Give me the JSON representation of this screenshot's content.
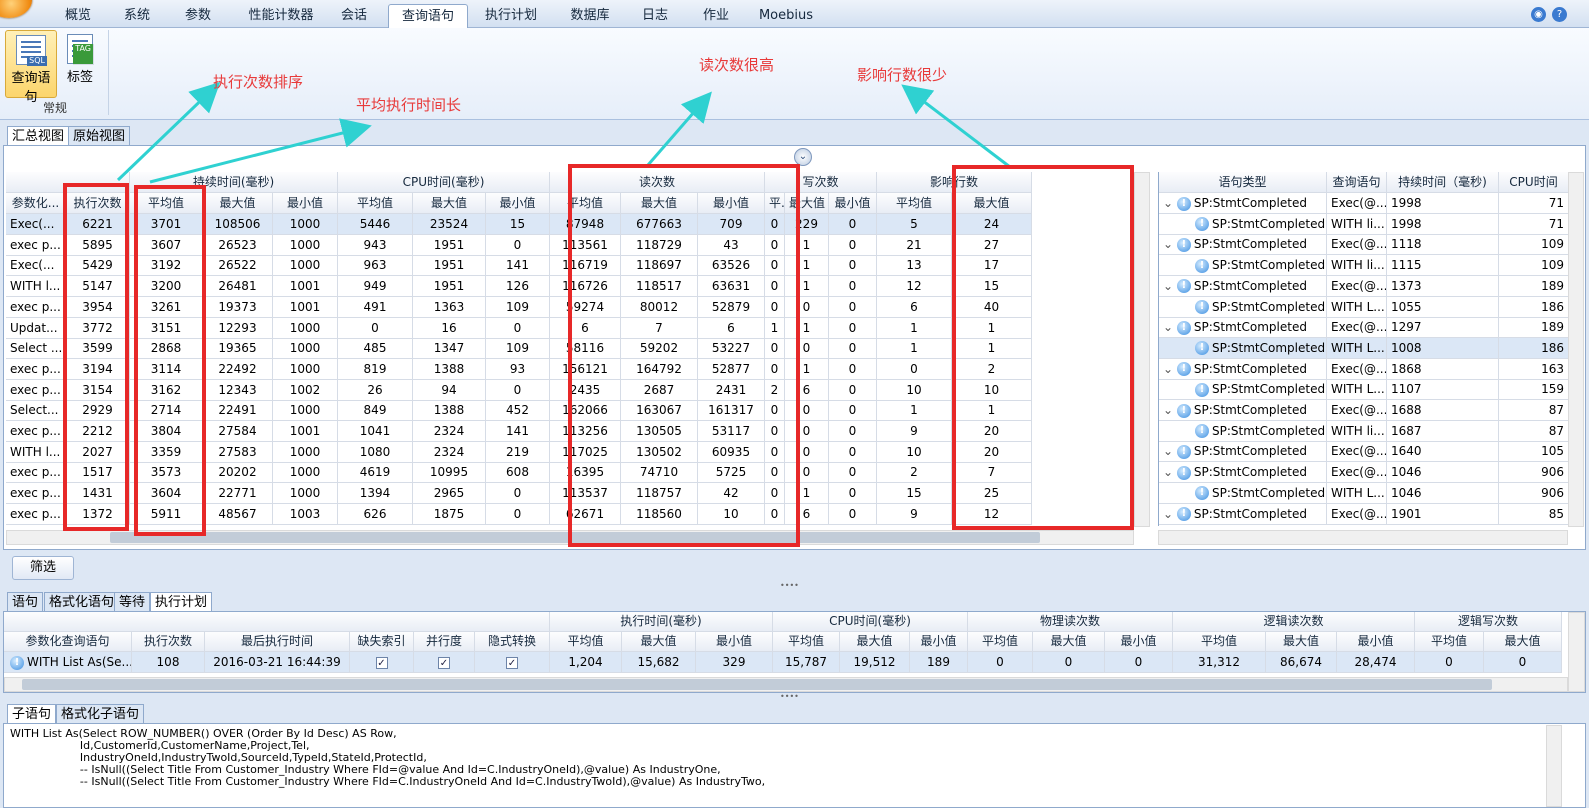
{
  "menu_tabs": [
    "概览",
    "系统",
    "参数",
    "性能计数器",
    "会话",
    "查询语句",
    "执行计划",
    "数据库",
    "日志",
    "作业",
    "Moebius"
  ],
  "ribbon": {
    "buttons": [
      {
        "label": "查询语句",
        "badge": "SQL"
      },
      {
        "label": "标签",
        "badge": "TAG"
      }
    ],
    "group": "常规"
  },
  "view_tabs": [
    "汇总视图",
    "原始视图"
  ],
  "summary": {
    "groups": [
      "持续时间(毫秒)",
      "CPU时间(毫秒)",
      "读次数",
      "写次数",
      "影响行数"
    ],
    "headers": [
      "参数化...",
      "执行次数",
      "平均值",
      "最大值",
      "最小值",
      "平均值",
      "最大值",
      "最小值",
      "平均值",
      "最大值",
      "最小值",
      "平...",
      "最大值",
      "最小值",
      "平均值",
      "最大值"
    ],
    "rows": [
      [
        "Exec(...",
        "6221",
        "3701",
        "108506",
        "1000",
        "5446",
        "23524",
        "15",
        "87948",
        "677663",
        "709",
        "0",
        "229",
        "0",
        "5",
        "24"
      ],
      [
        "exec p...",
        "5895",
        "3607",
        "26523",
        "1000",
        "943",
        "1951",
        "0",
        "113561",
        "118729",
        "43",
        "0",
        "1",
        "0",
        "21",
        "27"
      ],
      [
        "Exec(...",
        "5429",
        "3192",
        "26522",
        "1000",
        "963",
        "1951",
        "141",
        "116719",
        "118697",
        "63526",
        "0",
        "1",
        "0",
        "13",
        "17"
      ],
      [
        "WITH l...",
        "5147",
        "3200",
        "26481",
        "1001",
        "949",
        "1951",
        "126",
        "116726",
        "118517",
        "63631",
        "0",
        "1",
        "0",
        "12",
        "15"
      ],
      [
        "exec p...",
        "3954",
        "3261",
        "19373",
        "1001",
        "491",
        "1363",
        "109",
        "59274",
        "80012",
        "52879",
        "0",
        "0",
        "0",
        "6",
        "40"
      ],
      [
        "Updat...",
        "3772",
        "3151",
        "12293",
        "1000",
        "0",
        "16",
        "0",
        "6",
        "7",
        "6",
        "1",
        "1",
        "0",
        "1",
        "1"
      ],
      [
        "Select ...",
        "3599",
        "2868",
        "19365",
        "1000",
        "485",
        "1347",
        "109",
        "58116",
        "59202",
        "53227",
        "0",
        "0",
        "0",
        "1",
        "1"
      ],
      [
        "exec p...",
        "3194",
        "3114",
        "22492",
        "1000",
        "819",
        "1388",
        "93",
        "156121",
        "164792",
        "52877",
        "0",
        "1",
        "0",
        "0",
        "2"
      ],
      [
        "exec p...",
        "3154",
        "3162",
        "12343",
        "1002",
        "26",
        "94",
        "0",
        "2435",
        "2687",
        "2431",
        "2",
        "6",
        "0",
        "10",
        "10"
      ],
      [
        "Select...",
        "2929",
        "2714",
        "22491",
        "1000",
        "849",
        "1388",
        "452",
        "162066",
        "163067",
        "161317",
        "0",
        "0",
        "0",
        "1",
        "1"
      ],
      [
        "exec p...",
        "2212",
        "3804",
        "27584",
        "1001",
        "1041",
        "2324",
        "141",
        "113256",
        "130505",
        "53117",
        "0",
        "0",
        "0",
        "9",
        "20"
      ],
      [
        "WITH l...",
        "2027",
        "3359",
        "27583",
        "1000",
        "1080",
        "2324",
        "219",
        "117025",
        "130502",
        "60935",
        "0",
        "0",
        "0",
        "10",
        "20"
      ],
      [
        "exec p...",
        "1517",
        "3573",
        "20202",
        "1000",
        "4619",
        "10995",
        "608",
        "16395",
        "74710",
        "5725",
        "0",
        "0",
        "0",
        "2",
        "7"
      ],
      [
        "exec p...",
        "1431",
        "3604",
        "22771",
        "1000",
        "1394",
        "2965",
        "0",
        "113537",
        "118757",
        "42",
        "0",
        "1",
        "0",
        "15",
        "25"
      ],
      [
        "exec p...",
        "1372",
        "5911",
        "48567",
        "1003",
        "626",
        "1875",
        "0",
        "62671",
        "118560",
        "10",
        "0",
        "6",
        "0",
        "9",
        "12"
      ]
    ]
  },
  "annotations": [
    "执行次数排序",
    "平均执行时间长",
    "读次数很高",
    "影响行数很少"
  ],
  "events": {
    "headers": [
      "语句类型",
      "查询语句",
      "持续时间（毫秒)",
      "CPU时间"
    ],
    "rows": [
      {
        "type": "SP:StmtCompleted",
        "query": "Exec(@...",
        "dur": "1998",
        "cpu": "71",
        "parent": true
      },
      {
        "type": "SP:StmtCompleted",
        "query": "WITH li...",
        "dur": "1998",
        "cpu": "71",
        "parent": false
      },
      {
        "type": "SP:StmtCompleted",
        "query": "Exec(@...",
        "dur": "1118",
        "cpu": "109",
        "parent": true
      },
      {
        "type": "SP:StmtCompleted",
        "query": "WITH li...",
        "dur": "1115",
        "cpu": "109",
        "parent": false
      },
      {
        "type": "SP:StmtCompleted",
        "query": "Exec(@...",
        "dur": "1373",
        "cpu": "189",
        "parent": true
      },
      {
        "type": "SP:StmtCompleted",
        "query": "WITH L...",
        "dur": "1055",
        "cpu": "186",
        "parent": false
      },
      {
        "type": "SP:StmtCompleted",
        "query": "Exec(@...",
        "dur": "1297",
        "cpu": "189",
        "parent": true
      },
      {
        "type": "SP:StmtCompleted",
        "query": "WITH L...",
        "dur": "1008",
        "cpu": "186",
        "parent": false,
        "selected": true
      },
      {
        "type": "SP:StmtCompleted",
        "query": "Exec(@...",
        "dur": "1868",
        "cpu": "163",
        "parent": true
      },
      {
        "type": "SP:StmtCompleted",
        "query": "WITH L...",
        "dur": "1107",
        "cpu": "159",
        "parent": false
      },
      {
        "type": "SP:StmtCompleted",
        "query": "Exec(@...",
        "dur": "1688",
        "cpu": "87",
        "parent": true
      },
      {
        "type": "SP:StmtCompleted",
        "query": "WITH li...",
        "dur": "1687",
        "cpu": "87",
        "parent": false
      },
      {
        "type": "SP:StmtCompleted",
        "query": "Exec(@...",
        "dur": "1640",
        "cpu": "105",
        "parent": true
      },
      {
        "type": "SP:StmtCompleted",
        "query": "Exec(@...",
        "dur": "1046",
        "cpu": "906",
        "parent": true
      },
      {
        "type": "SP:StmtCompleted",
        "query": "WITH L...",
        "dur": "1046",
        "cpu": "906",
        "parent": false
      },
      {
        "type": "SP:StmtCompleted",
        "query": "Exec(@...",
        "dur": "1901",
        "cpu": "85",
        "parent": true
      }
    ]
  },
  "filter_button": "筛选",
  "detail_tabs": [
    "语句",
    "格式化语句",
    "等待",
    "执行计划"
  ],
  "detail": {
    "groups": [
      "执行时间(毫秒)",
      "CPU时间(毫秒)",
      "物理读次数",
      "逻辑读次数",
      "逻辑写次数"
    ],
    "headers": [
      "参数化查询语句",
      "执行次数",
      "最后执行时间",
      "缺失索引",
      "并行度",
      "隐式转换",
      "平均值",
      "最大值",
      "最小值",
      "平均值",
      "最大值",
      "最小值",
      "平均值",
      "最大值",
      "最小值",
      "平均值",
      "最大值",
      "最小值",
      "平均值",
      "最大值"
    ],
    "row": [
      "WITH List As(Se...",
      "108",
      "2016-03-21 16:44:39",
      "",
      "",
      "",
      "1,204",
      "15,682",
      "329",
      "15,787",
      "19,512",
      "189",
      "0",
      "0",
      "0",
      "31,312",
      "86,674",
      "28,474",
      "0",
      "0"
    ]
  },
  "sub_tabs": [
    "子语句",
    "格式化子语句"
  ],
  "sql_lines": [
    "WITH List As(Select ROW_NUMBER() OVER (Order By Id Desc) AS Row,",
    "                    Id,CustomerId,CustomerName,Project,Tel,",
    "                    IndustryOneId,IndustryTwoId,SourceId,TypeId,StateId,ProtectId,",
    "                    -- IsNull((Select Title From Customer_Industry Where FId=@value And Id=C.IndustryOneId),@value) As IndustryOne,",
    "                    -- IsNull((Select Title From Customer_Industry Where FId=C.IndustryOneId And Id=C.IndustryTwoId),@value) As IndustryTwo,"
  ]
}
